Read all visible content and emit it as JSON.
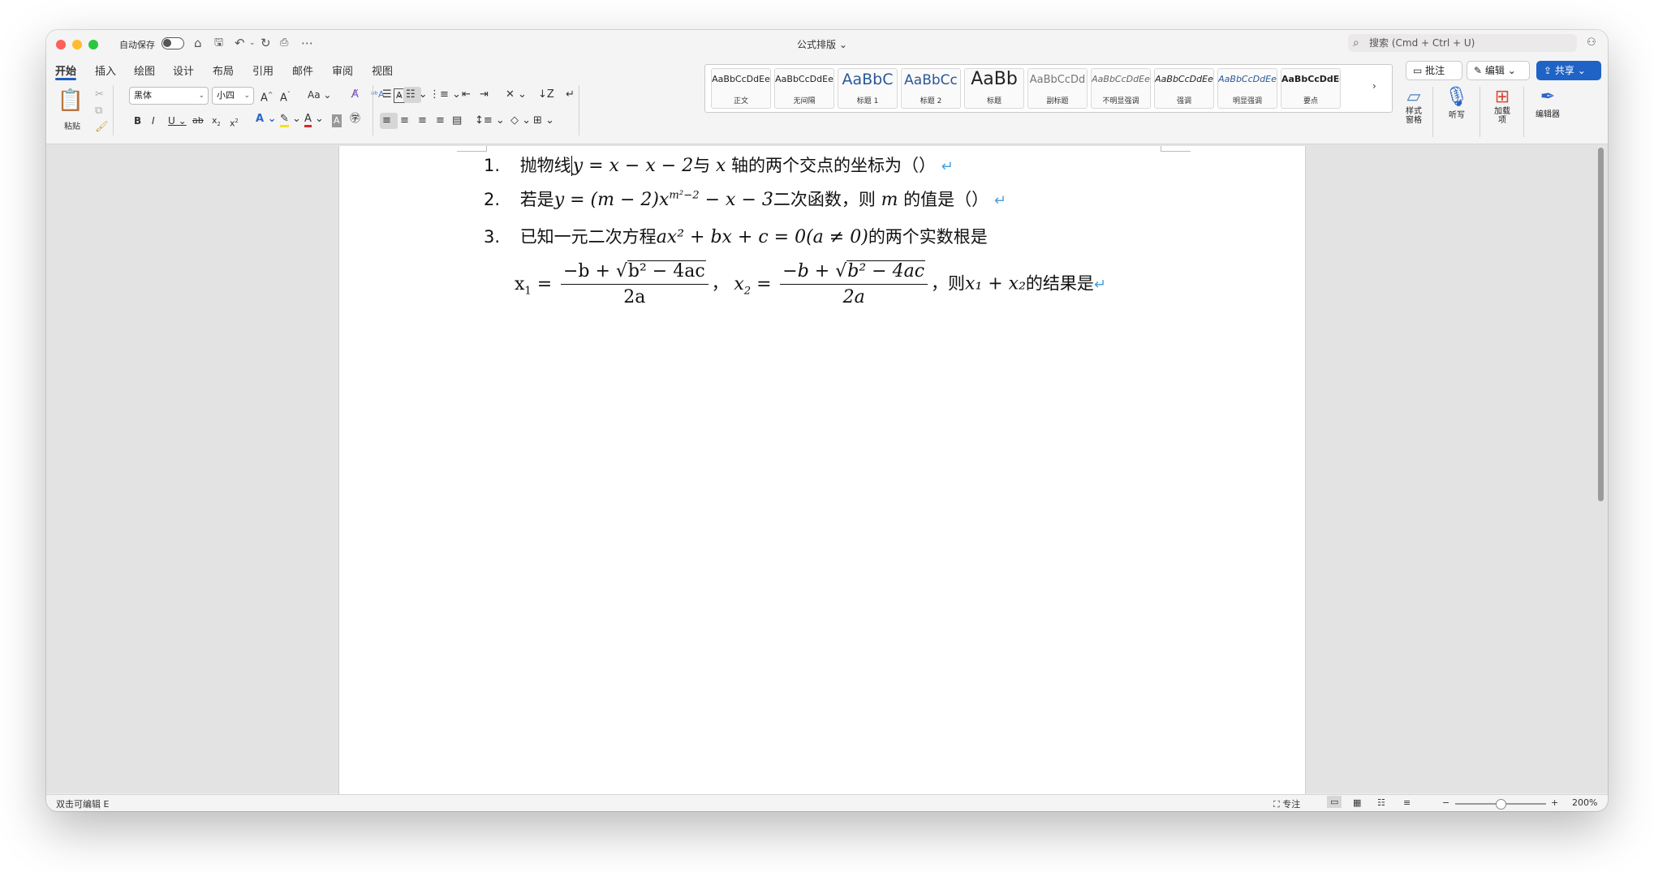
{
  "window": {
    "autosave_label": "自动保存",
    "doc_title": "公式排版",
    "search_placeholder": "搜索 (Cmd + Ctrl + U)"
  },
  "tabs": [
    {
      "label": "开始",
      "active": true
    },
    {
      "label": "插入"
    },
    {
      "label": "绘图"
    },
    {
      "label": "设计"
    },
    {
      "label": "布局"
    },
    {
      "label": "引用"
    },
    {
      "label": "邮件"
    },
    {
      "label": "审阅"
    },
    {
      "label": "视图"
    }
  ],
  "header_buttons": {
    "comment": "批注",
    "edit": "编辑",
    "share": "共享"
  },
  "ribbon": {
    "paste_label": "粘贴",
    "font_name": "黑体",
    "font_size": "小四",
    "styles": [
      {
        "sample": "AaBbCcDdEe",
        "name": "正文"
      },
      {
        "sample": "AaBbCcDdEe",
        "name": "无间隔"
      },
      {
        "sample": "AaBbC",
        "name": "标题 1"
      },
      {
        "sample": "AaBbCc",
        "name": "标题 2"
      },
      {
        "sample": "AaBb",
        "name": "标题"
      },
      {
        "sample": "AaBbCcDd",
        "name": "副标题"
      },
      {
        "sample": "AaBbCcDdEe",
        "name": "不明显强调"
      },
      {
        "sample": "AaBbCcDdEe",
        "name": "强调"
      },
      {
        "sample": "AaBbCcDdEe",
        "name": "明显强调"
      },
      {
        "sample": "AaBbCcDdEe",
        "name": "要点"
      }
    ],
    "style_pane": "样式\n窗格",
    "dictate": "听写",
    "addins": "加载\n项",
    "editor": "编辑器"
  },
  "document": {
    "q1": {
      "num": "1.",
      "prefix": "抛物线",
      "math": "y = x − x − 2",
      "mid": "与",
      "var_x": "x",
      "suffix": "轴的两个交点的坐标为（）"
    },
    "q2": {
      "num": "2.",
      "prefix": "若是",
      "math_pre": "y = (m − 2)x",
      "sup": "m²−2",
      "math_post": " − x − 3",
      "mid": "二次函数，则",
      "var_m": "m",
      "suffix": "的值是（）"
    },
    "q3": {
      "num": "3.",
      "prefix": "已知一元二次方程",
      "math": "ax² + bx + c = 0(a ≠ 0)",
      "suffix": "的两个实数根是"
    },
    "q3_line2": {
      "x1": "x",
      "x1_sub": "1",
      "frac1_num_pre": "−b + ",
      "frac1_rad": "b² − 4ac",
      "frac1_den": "2a",
      "x2": "x",
      "x2_sub": "2",
      "frac2_num_pre": "−b + ",
      "frac2_rad": "b² − 4ac",
      "frac2_den": "2a",
      "comma": "，",
      "then": "，则",
      "sum": "x₁ + x₂",
      "suffix": "的结果是"
    }
  },
  "statusbar": {
    "left": "双击可编辑 E",
    "focus": "专注",
    "zoom": "200%"
  }
}
